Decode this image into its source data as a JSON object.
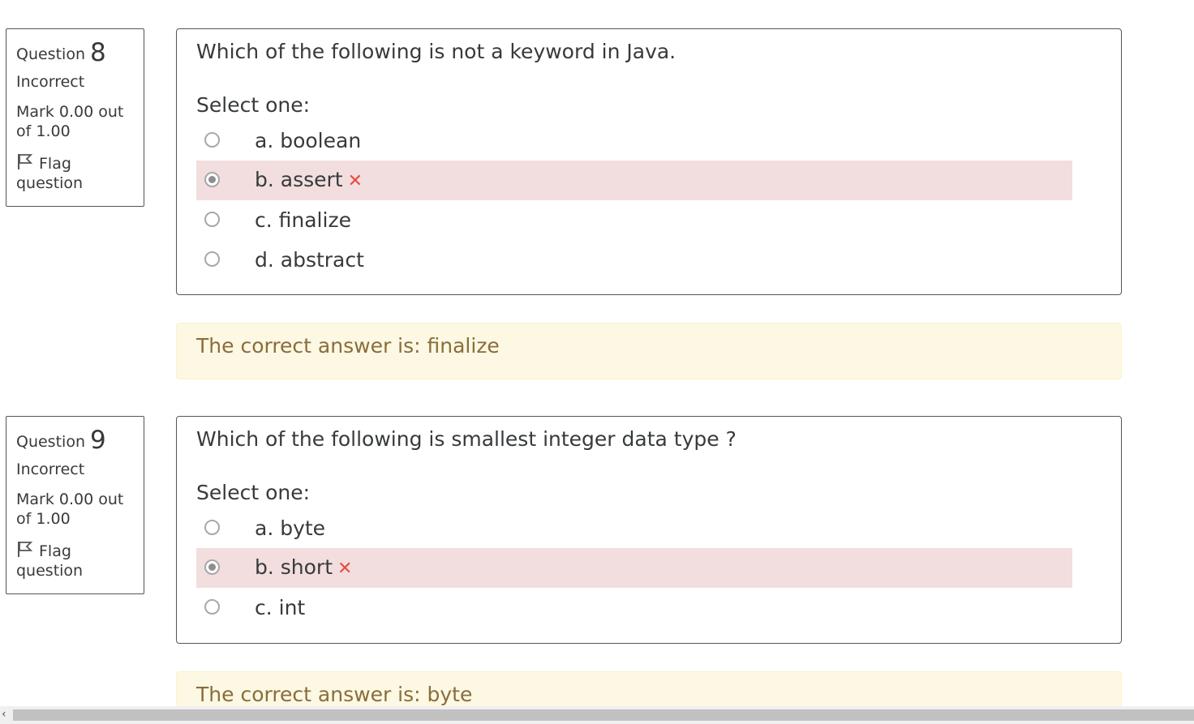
{
  "questions": [
    {
      "label": "Question",
      "number": "8",
      "state": "Incorrect",
      "mark": "Mark 0.00 out of 1.00",
      "flag_label": "Flag question",
      "text": "Which of the following is not a keyword in Java.",
      "prompt": "Select one:",
      "options": [
        {
          "label": "a. boolean",
          "checked": false
        },
        {
          "label": "b. assert",
          "checked": true,
          "incorrect": true
        },
        {
          "label": "c. finalize",
          "checked": false
        },
        {
          "label": "d. abstract",
          "checked": false
        }
      ],
      "feedback": "The correct answer is: finalize"
    },
    {
      "label": "Question",
      "number": "9",
      "state": "Incorrect",
      "mark": "Mark 0.00 out of 1.00",
      "flag_label": "Flag question",
      "text": "Which of the following is smallest integer data type ?",
      "prompt": "Select one:",
      "options": [
        {
          "label": "a. byte",
          "checked": false
        },
        {
          "label": "b. short",
          "checked": true,
          "incorrect": true
        },
        {
          "label": "c. int",
          "checked": false
        }
      ],
      "feedback": "The correct answer is: byte"
    }
  ],
  "icons": {
    "flag": "flag-icon",
    "incorrect": "cross-icon",
    "scroll_left": "chevron-left-icon"
  },
  "colors": {
    "incorrect_bg": "#f2dede",
    "incorrect_mark": "#e74c3c",
    "feedback_bg": "#fcf8e3",
    "feedback_text": "#8a6d3b"
  }
}
